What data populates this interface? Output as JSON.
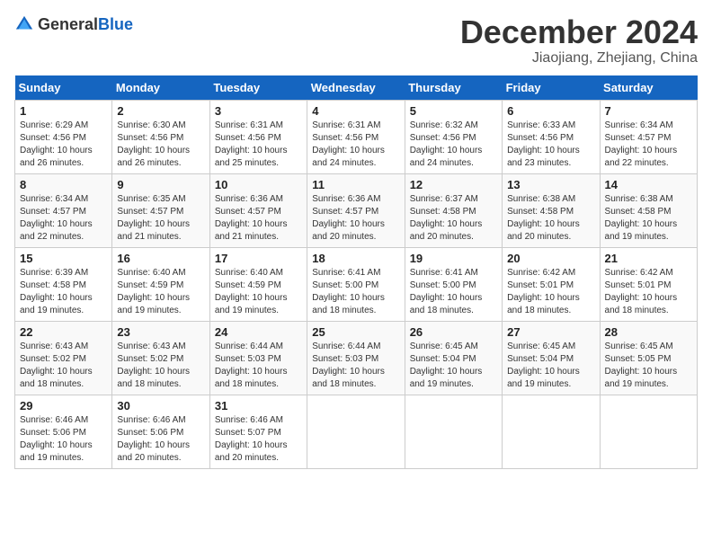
{
  "logo": {
    "text_general": "General",
    "text_blue": "Blue"
  },
  "header": {
    "month_year": "December 2024",
    "location": "Jiaojiang, Zhejiang, China"
  },
  "weekdays": [
    "Sunday",
    "Monday",
    "Tuesday",
    "Wednesday",
    "Thursday",
    "Friday",
    "Saturday"
  ],
  "weeks": [
    [
      {
        "day": "1",
        "sunrise": "Sunrise: 6:29 AM",
        "sunset": "Sunset: 4:56 PM",
        "daylight": "Daylight: 10 hours and 26 minutes."
      },
      {
        "day": "2",
        "sunrise": "Sunrise: 6:30 AM",
        "sunset": "Sunset: 4:56 PM",
        "daylight": "Daylight: 10 hours and 26 minutes."
      },
      {
        "day": "3",
        "sunrise": "Sunrise: 6:31 AM",
        "sunset": "Sunset: 4:56 PM",
        "daylight": "Daylight: 10 hours and 25 minutes."
      },
      {
        "day": "4",
        "sunrise": "Sunrise: 6:31 AM",
        "sunset": "Sunset: 4:56 PM",
        "daylight": "Daylight: 10 hours and 24 minutes."
      },
      {
        "day": "5",
        "sunrise": "Sunrise: 6:32 AM",
        "sunset": "Sunset: 4:56 PM",
        "daylight": "Daylight: 10 hours and 24 minutes."
      },
      {
        "day": "6",
        "sunrise": "Sunrise: 6:33 AM",
        "sunset": "Sunset: 4:56 PM",
        "daylight": "Daylight: 10 hours and 23 minutes."
      },
      {
        "day": "7",
        "sunrise": "Sunrise: 6:34 AM",
        "sunset": "Sunset: 4:57 PM",
        "daylight": "Daylight: 10 hours and 22 minutes."
      }
    ],
    [
      {
        "day": "8",
        "sunrise": "Sunrise: 6:34 AM",
        "sunset": "Sunset: 4:57 PM",
        "daylight": "Daylight: 10 hours and 22 minutes."
      },
      {
        "day": "9",
        "sunrise": "Sunrise: 6:35 AM",
        "sunset": "Sunset: 4:57 PM",
        "daylight": "Daylight: 10 hours and 21 minutes."
      },
      {
        "day": "10",
        "sunrise": "Sunrise: 6:36 AM",
        "sunset": "Sunset: 4:57 PM",
        "daylight": "Daylight: 10 hours and 21 minutes."
      },
      {
        "day": "11",
        "sunrise": "Sunrise: 6:36 AM",
        "sunset": "Sunset: 4:57 PM",
        "daylight": "Daylight: 10 hours and 20 minutes."
      },
      {
        "day": "12",
        "sunrise": "Sunrise: 6:37 AM",
        "sunset": "Sunset: 4:58 PM",
        "daylight": "Daylight: 10 hours and 20 minutes."
      },
      {
        "day": "13",
        "sunrise": "Sunrise: 6:38 AM",
        "sunset": "Sunset: 4:58 PM",
        "daylight": "Daylight: 10 hours and 20 minutes."
      },
      {
        "day": "14",
        "sunrise": "Sunrise: 6:38 AM",
        "sunset": "Sunset: 4:58 PM",
        "daylight": "Daylight: 10 hours and 19 minutes."
      }
    ],
    [
      {
        "day": "15",
        "sunrise": "Sunrise: 6:39 AM",
        "sunset": "Sunset: 4:58 PM",
        "daylight": "Daylight: 10 hours and 19 minutes."
      },
      {
        "day": "16",
        "sunrise": "Sunrise: 6:40 AM",
        "sunset": "Sunset: 4:59 PM",
        "daylight": "Daylight: 10 hours and 19 minutes."
      },
      {
        "day": "17",
        "sunrise": "Sunrise: 6:40 AM",
        "sunset": "Sunset: 4:59 PM",
        "daylight": "Daylight: 10 hours and 19 minutes."
      },
      {
        "day": "18",
        "sunrise": "Sunrise: 6:41 AM",
        "sunset": "Sunset: 5:00 PM",
        "daylight": "Daylight: 10 hours and 18 minutes."
      },
      {
        "day": "19",
        "sunrise": "Sunrise: 6:41 AM",
        "sunset": "Sunset: 5:00 PM",
        "daylight": "Daylight: 10 hours and 18 minutes."
      },
      {
        "day": "20",
        "sunrise": "Sunrise: 6:42 AM",
        "sunset": "Sunset: 5:01 PM",
        "daylight": "Daylight: 10 hours and 18 minutes."
      },
      {
        "day": "21",
        "sunrise": "Sunrise: 6:42 AM",
        "sunset": "Sunset: 5:01 PM",
        "daylight": "Daylight: 10 hours and 18 minutes."
      }
    ],
    [
      {
        "day": "22",
        "sunrise": "Sunrise: 6:43 AM",
        "sunset": "Sunset: 5:02 PM",
        "daylight": "Daylight: 10 hours and 18 minutes."
      },
      {
        "day": "23",
        "sunrise": "Sunrise: 6:43 AM",
        "sunset": "Sunset: 5:02 PM",
        "daylight": "Daylight: 10 hours and 18 minutes."
      },
      {
        "day": "24",
        "sunrise": "Sunrise: 6:44 AM",
        "sunset": "Sunset: 5:03 PM",
        "daylight": "Daylight: 10 hours and 18 minutes."
      },
      {
        "day": "25",
        "sunrise": "Sunrise: 6:44 AM",
        "sunset": "Sunset: 5:03 PM",
        "daylight": "Daylight: 10 hours and 18 minutes."
      },
      {
        "day": "26",
        "sunrise": "Sunrise: 6:45 AM",
        "sunset": "Sunset: 5:04 PM",
        "daylight": "Daylight: 10 hours and 19 minutes."
      },
      {
        "day": "27",
        "sunrise": "Sunrise: 6:45 AM",
        "sunset": "Sunset: 5:04 PM",
        "daylight": "Daylight: 10 hours and 19 minutes."
      },
      {
        "day": "28",
        "sunrise": "Sunrise: 6:45 AM",
        "sunset": "Sunset: 5:05 PM",
        "daylight": "Daylight: 10 hours and 19 minutes."
      }
    ],
    [
      {
        "day": "29",
        "sunrise": "Sunrise: 6:46 AM",
        "sunset": "Sunset: 5:06 PM",
        "daylight": "Daylight: 10 hours and 19 minutes."
      },
      {
        "day": "30",
        "sunrise": "Sunrise: 6:46 AM",
        "sunset": "Sunset: 5:06 PM",
        "daylight": "Daylight: 10 hours and 20 minutes."
      },
      {
        "day": "31",
        "sunrise": "Sunrise: 6:46 AM",
        "sunset": "Sunset: 5:07 PM",
        "daylight": "Daylight: 10 hours and 20 minutes."
      },
      null,
      null,
      null,
      null
    ]
  ]
}
